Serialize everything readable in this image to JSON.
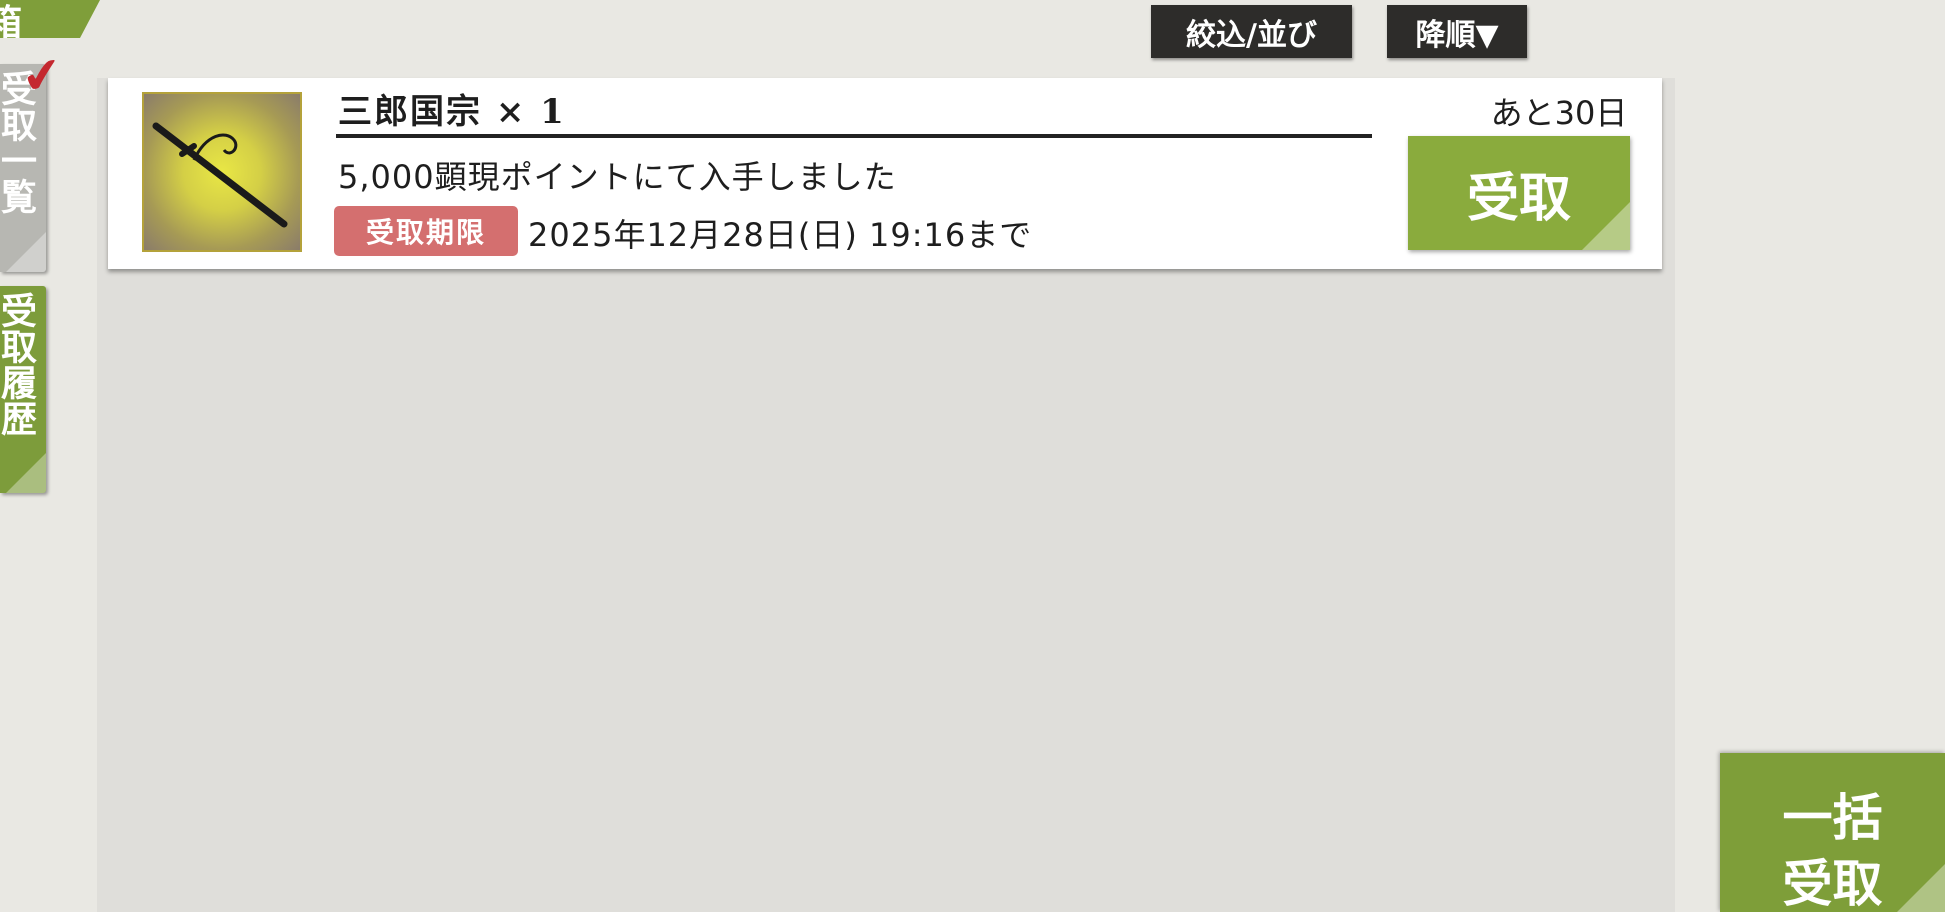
{
  "header": {
    "title_fragment": "箱"
  },
  "side_tabs": [
    {
      "label": "受取一覧",
      "selected": true
    },
    {
      "label": "受取履歴",
      "selected": false
    }
  ],
  "toolbar": {
    "filter_sort_label": "絞込/並び",
    "order_label": "降順▼"
  },
  "items": [
    {
      "name": "三郎国宗 × 1",
      "description": "5,000顕現ポイントにて入手しました",
      "deadline_badge": "受取期限",
      "deadline_text": "2025年12月28日(日) 19:16まで",
      "remaining": "あと30日",
      "receive_label": "受取",
      "icon": "katana-icon"
    }
  ],
  "bulk": {
    "line1": "一括",
    "line2": "受取"
  },
  "colors": {
    "accent_green": "#8aab3d",
    "deadline_red": "#d46f6f",
    "button_dark": "#2d2c2a",
    "check_red": "#c4282f"
  }
}
